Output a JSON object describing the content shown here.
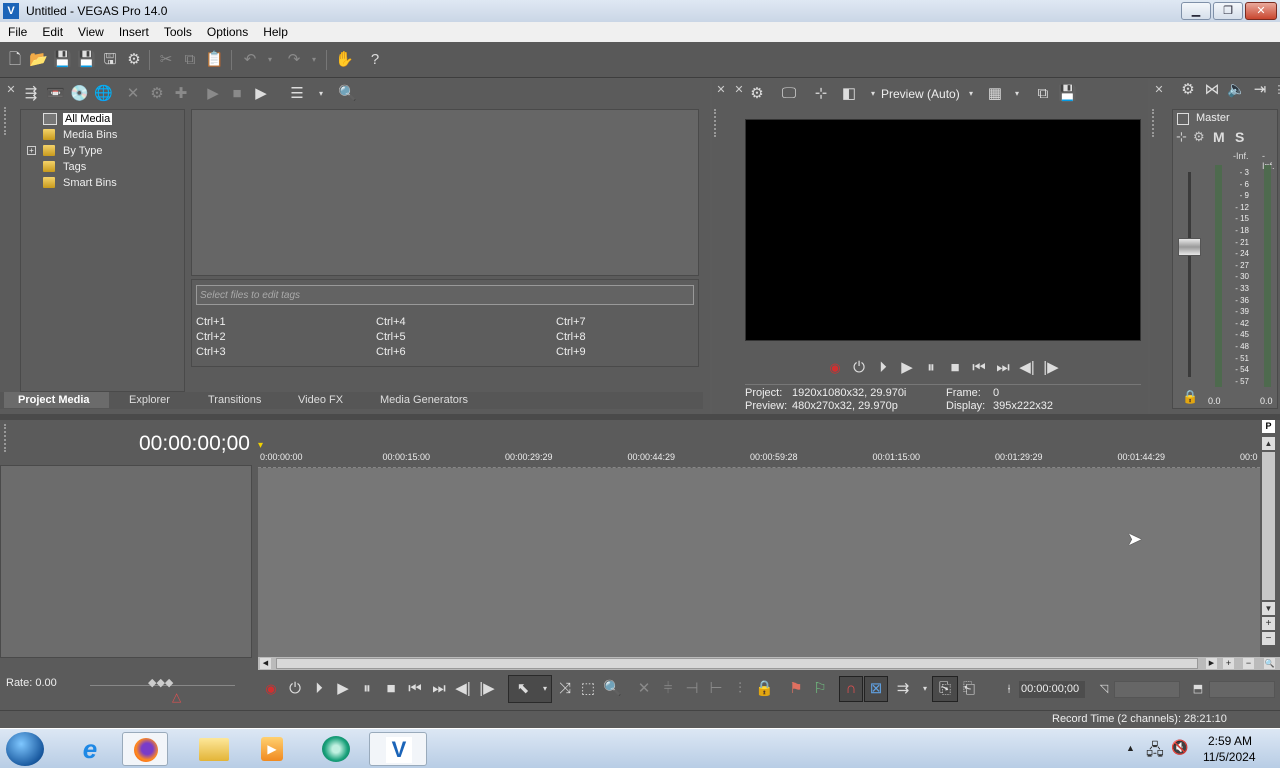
{
  "window": {
    "title": "Untitled - VEGAS Pro 14.0",
    "min": "▁",
    "max": "❐",
    "close": "✕"
  },
  "menu": [
    "File",
    "Edit",
    "View",
    "Insert",
    "Tools",
    "Options",
    "Help"
  ],
  "media_tree": [
    "All Media",
    "Media Bins",
    "By Type",
    "Tags",
    "Smart Bins"
  ],
  "tags": {
    "placeholder": "Select files to edit tags",
    "shortcuts": [
      "Ctrl+1",
      "Ctrl+4",
      "Ctrl+7",
      "Ctrl+2",
      "Ctrl+5",
      "Ctrl+8",
      "Ctrl+3",
      "Ctrl+6",
      "Ctrl+9"
    ]
  },
  "tabs": [
    "Project Media",
    "Explorer",
    "Transitions",
    "Video FX",
    "Media Generators"
  ],
  "preview": {
    "mode": "Preview (Auto)",
    "project_label": "Project:",
    "project_value": "1920x1080x32, 29.970i",
    "preview_label": "Preview:",
    "preview_value": "480x270x32, 29.970p",
    "frame_label": "Frame:",
    "frame_value": "0",
    "display_label": "Display:",
    "display_value": "395x222x32"
  },
  "master": {
    "title": "Master",
    "m": "M",
    "s": "S",
    "peak_left": "-Inf.",
    "peak_right": "-Inf.",
    "scale": [
      "3",
      "6",
      "9",
      "12",
      "15",
      "18",
      "21",
      "24",
      "27",
      "30",
      "33",
      "36",
      "39",
      "42",
      "45",
      "48",
      "51",
      "54",
      "57"
    ],
    "level_left": "0.0",
    "level_right": "0.0"
  },
  "timeline": {
    "timecode": "00:00:00;00",
    "ruler": [
      "0:00:00:00",
      "00:00:15:00",
      "00:00:29:29",
      "00:00:44:29",
      "00:00:59:28",
      "00:01:15:00",
      "00:01:29:29",
      "00:01:44:29",
      "00:0"
    ],
    "rate": "Rate: 0.00",
    "cursor_time": "00:00:00;00",
    "record_time": "Record Time (2 channels): 28:21:10"
  },
  "taskbar": {
    "time": "2:59 AM",
    "date": "11/5/2024"
  },
  "colors": {
    "accent": "#1b64b8",
    "record": "#d03030",
    "taskbar": "#c9d8ea"
  }
}
